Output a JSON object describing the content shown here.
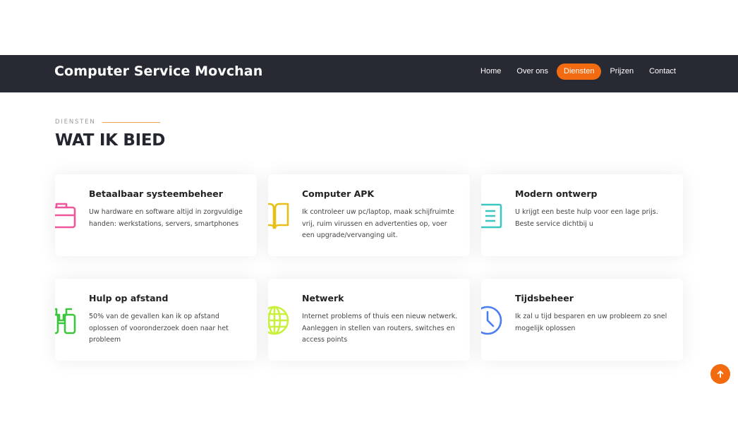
{
  "header": {
    "brand": "Computer Service Movchan",
    "nav": [
      {
        "label": "Home",
        "active": false
      },
      {
        "label": "Over ons",
        "active": false
      },
      {
        "label": "Diensten",
        "active": true
      },
      {
        "label": "Prijzen",
        "active": false
      },
      {
        "label": "Contact",
        "active": false
      }
    ],
    "accent_color": "#f26b10",
    "bar_color": "#272a33"
  },
  "section": {
    "eyebrow": "DIENSTEN",
    "title": "WAT IK BIED"
  },
  "services": [
    {
      "title": "Betaalbaar systeembeheer",
      "text": "Uw hardware en software altijd in zorgvuldige handen: werkstations, servers, smartphones",
      "icon": "briefcase-icon",
      "color": "#f0569b"
    },
    {
      "title": "Computer APK",
      "text": "Ik controleer uw pc/laptop, maak schijfruimte vrij, ruim virussen en advertenties op, voer een upgrade/vervanging uit.",
      "icon": "book-icon",
      "color": "#e7bf18"
    },
    {
      "title": "Modern ontwerp",
      "text": "U krijgt een beste hulp voor een lage prijs. Beste service dichtbij u",
      "icon": "list-icon",
      "color": "#3ec6c0"
    },
    {
      "title": "Hulp op afstand",
      "text": "50% van de gevallen kan ik op afstand oplossen of vooronderzoek doen naar het probleem",
      "icon": "binoculars-icon",
      "color": "#3bc63b"
    },
    {
      "title": "Netwerk",
      "text": "Internet problems of thuis een nieuw netwerk. Aanleggen in stellen van routers, switches en access points",
      "icon": "globe-icon",
      "color": "#c8f03c"
    },
    {
      "title": "Tijdsbeheer",
      "text": "Ik zal u tijd besparen en uw probleem zo snel mogelijk oplossen",
      "icon": "clock-icon",
      "color": "#4a7ef0"
    }
  ],
  "back_to_top": {
    "icon": "arrow-up-icon"
  }
}
